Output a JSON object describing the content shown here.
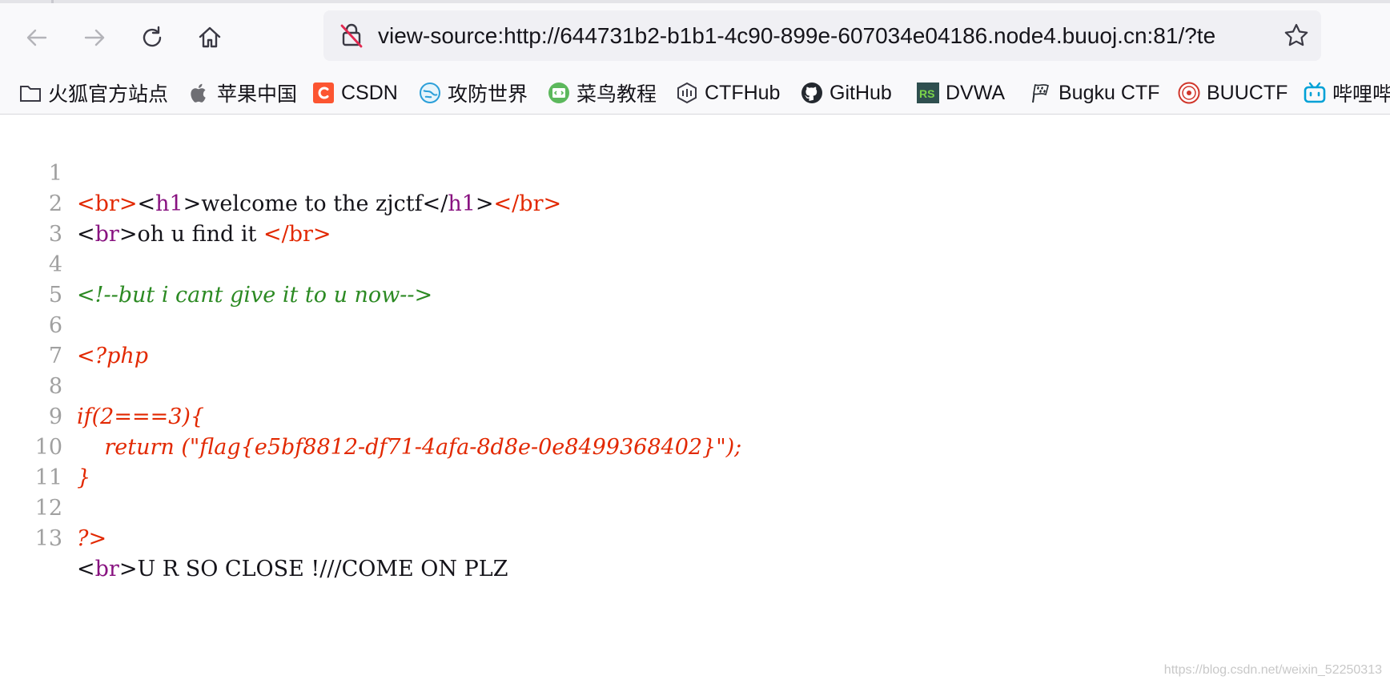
{
  "browser": {
    "url": "view-source:http://644731b2-b1b1-4c90-899e-607034e04186.node4.buuoj.cn:81/?te",
    "accent_colors": {
      "tag": "#e22800",
      "tag_name": "#881280",
      "comment": "#2c8a23",
      "line_number": "#a0a0a0"
    }
  },
  "bookmarks": [
    {
      "label": "火狐官方站点",
      "icon": "folder-icon"
    },
    {
      "label": "苹果中国",
      "icon": "apple-icon"
    },
    {
      "label": "CSDN",
      "icon": "csdn-icon"
    },
    {
      "label": "攻防世界",
      "icon": "globe-icon"
    },
    {
      "label": "菜鸟教程",
      "icon": "runoob-icon"
    },
    {
      "label": "CTFHub",
      "icon": "ctfhub-icon"
    },
    {
      "label": "GitHub",
      "icon": "github-icon"
    },
    {
      "label": "DVWA",
      "icon": "dvwa-icon"
    },
    {
      "label": "Bugku CTF",
      "icon": "flag-icon"
    },
    {
      "label": "BUUCTF",
      "icon": "buuctf-icon"
    },
    {
      "label": "哔哩哔",
      "icon": "bilibili-icon"
    }
  ],
  "source": {
    "line_numbers": [
      "1",
      "2",
      "3",
      "4",
      "5",
      "6",
      "7",
      "8",
      "9",
      "10",
      "11",
      "12",
      "13"
    ],
    "l1": {
      "open_br": "<",
      "br1": "br",
      "close1": ">",
      "open_h1": "<",
      "h1a": "h1",
      "close2": ">",
      "text": "welcome to the zjctf",
      "open_h1c": "</",
      "h1b": "h1",
      "close3": ">",
      "open_brc": "</",
      "br2": "br",
      "close4": ">"
    },
    "l2": {
      "open": "<",
      "br": "br",
      "close": ">",
      "text": "oh u find it ",
      "copen": "</",
      "br2": "br",
      "cclose": ">"
    },
    "l4": "<!--but i cant give it to u now-->",
    "l6": "<?php",
    "l8": "if(2===3){",
    "l9": "    return (\"flag{e5bf8812-df71-4afa-8d8e-0e8499368402}\");",
    "l10": "}",
    "l12": "?>",
    "l13": {
      "open": "<",
      "br": "br",
      "close": ">",
      "text": "U R SO CLOSE !///COME ON PLZ"
    }
  },
  "watermark": "https://blog.csdn.net/weixin_52250313"
}
